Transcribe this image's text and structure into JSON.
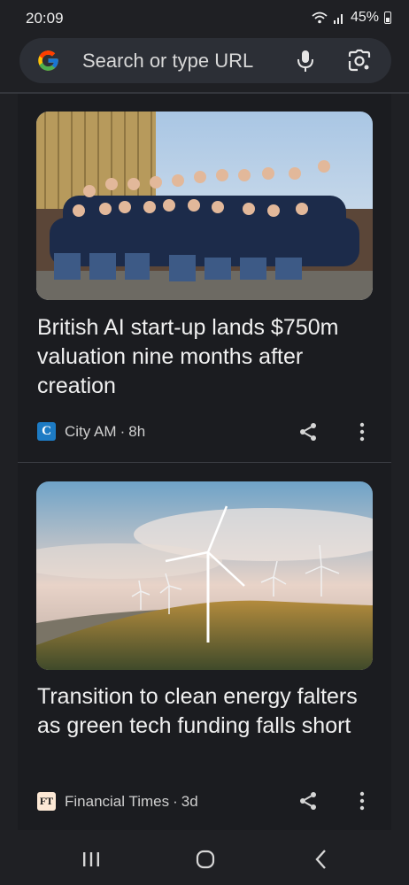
{
  "status_bar": {
    "time": "20:09",
    "battery": "45%",
    "icons": [
      "wifi-icon",
      "signal-icon",
      "battery-icon"
    ]
  },
  "search_bar": {
    "placeholder": "Search or type URL",
    "icons": [
      "google-logo-icon",
      "mic-icon",
      "lens-camera-icon"
    ]
  },
  "feed": {
    "articles": [
      {
        "headline": "British AI start-up lands $750m valuation nine months after creation",
        "source": "City AM",
        "age": "8h",
        "source_logo_text": "C",
        "source_logo_color": "#1d7bc4",
        "image": "team-group-photo",
        "actions": [
          "share-icon",
          "more-options-icon"
        ]
      },
      {
        "headline": "Transition to clean energy falters as green tech funding falls short",
        "source": "Financial Times",
        "age": "3d",
        "source_logo_text": "FT",
        "source_logo_color": "#fce8d5",
        "image": "wind-turbines-photo",
        "actions": [
          "share-icon",
          "more-options-icon"
        ]
      }
    ],
    "separator": "·"
  },
  "nav_bar": {
    "icons": [
      "recent-apps-icon",
      "home-icon",
      "back-icon"
    ]
  },
  "colors": {
    "background": "#1f2024",
    "card": "#1b1c20",
    "search_bg": "#2c2f36",
    "text_primary": "#f0f0f0",
    "text_secondary": "#cfcfcf"
  }
}
